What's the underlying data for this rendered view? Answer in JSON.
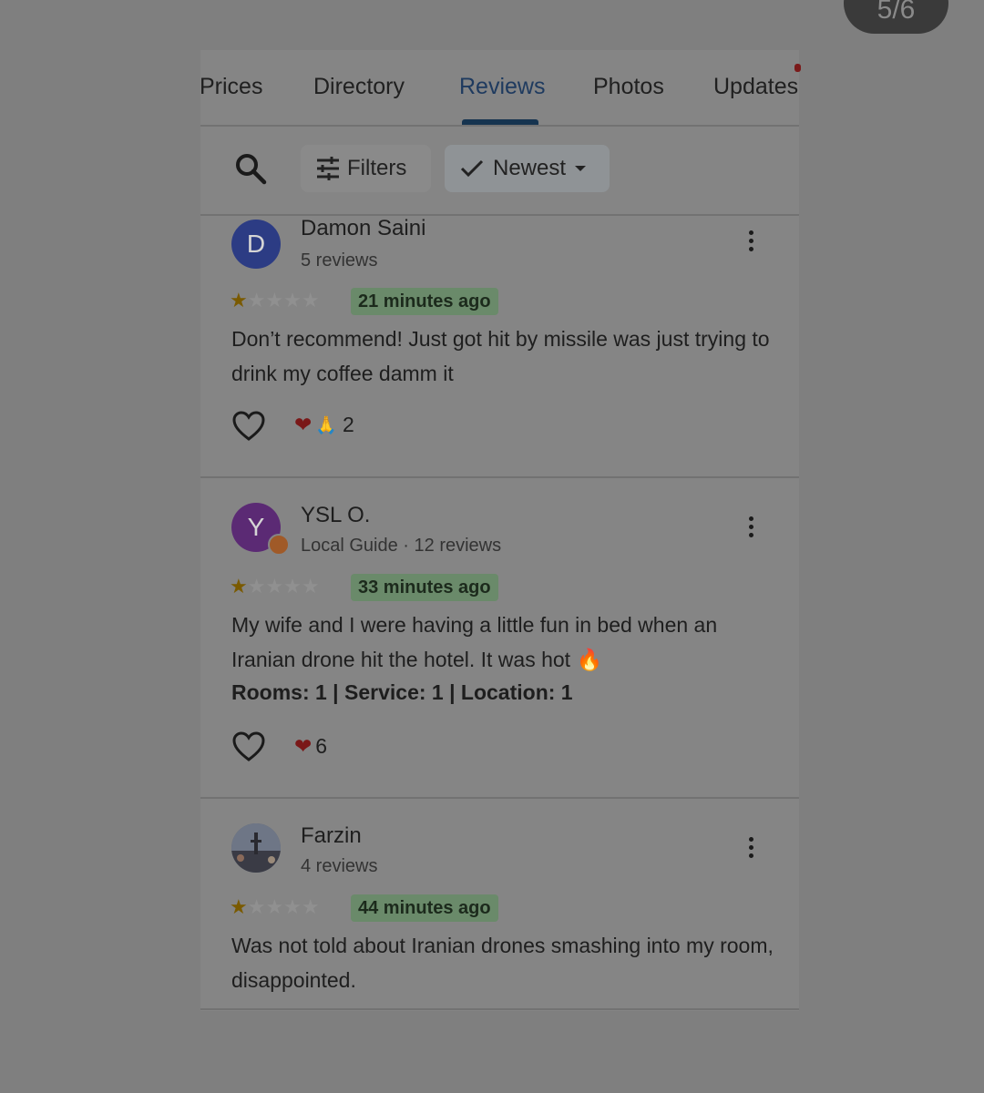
{
  "counter": "5/6",
  "tabs": [
    {
      "label": "Prices"
    },
    {
      "label": "Directory"
    },
    {
      "label": "Reviews",
      "active": true
    },
    {
      "label": "Photos"
    },
    {
      "label": "Updates"
    }
  ],
  "toolbar": {
    "filters_label": "Filters",
    "sort_label": "Newest"
  },
  "reviews": [
    {
      "avatar_letter": "D",
      "name": "Damon Saini",
      "subtitle": "5 reviews",
      "rating": 1,
      "time": "21 minutes ago",
      "text": "Don’t recommend! Just got hit by missile was just trying to drink my coffee damm it",
      "reactions_count": "2"
    },
    {
      "avatar_letter": "Y",
      "name": "YSL O.",
      "subtitle": "Local Guide · 12 reviews",
      "rating": 1,
      "time": "33 minutes ago",
      "text": "My wife and I were having a little fun in bed when an Iranian drone hit the hotel. It was hot 🔥",
      "ratings_line": "Rooms: 1 | Service: 1 | Location: 1",
      "reactions_count": "6"
    },
    {
      "name": "Farzin",
      "subtitle": "4 reviews",
      "rating": 1,
      "time": "44 minutes ago",
      "text": "Was not told about Iranian drones smashing into my room, disappointed."
    }
  ],
  "colors": {
    "page_bg": "#7f7f7f",
    "card_bg": "#858585",
    "active_tab": "#163450",
    "time_badge": "#6a8a6a"
  }
}
